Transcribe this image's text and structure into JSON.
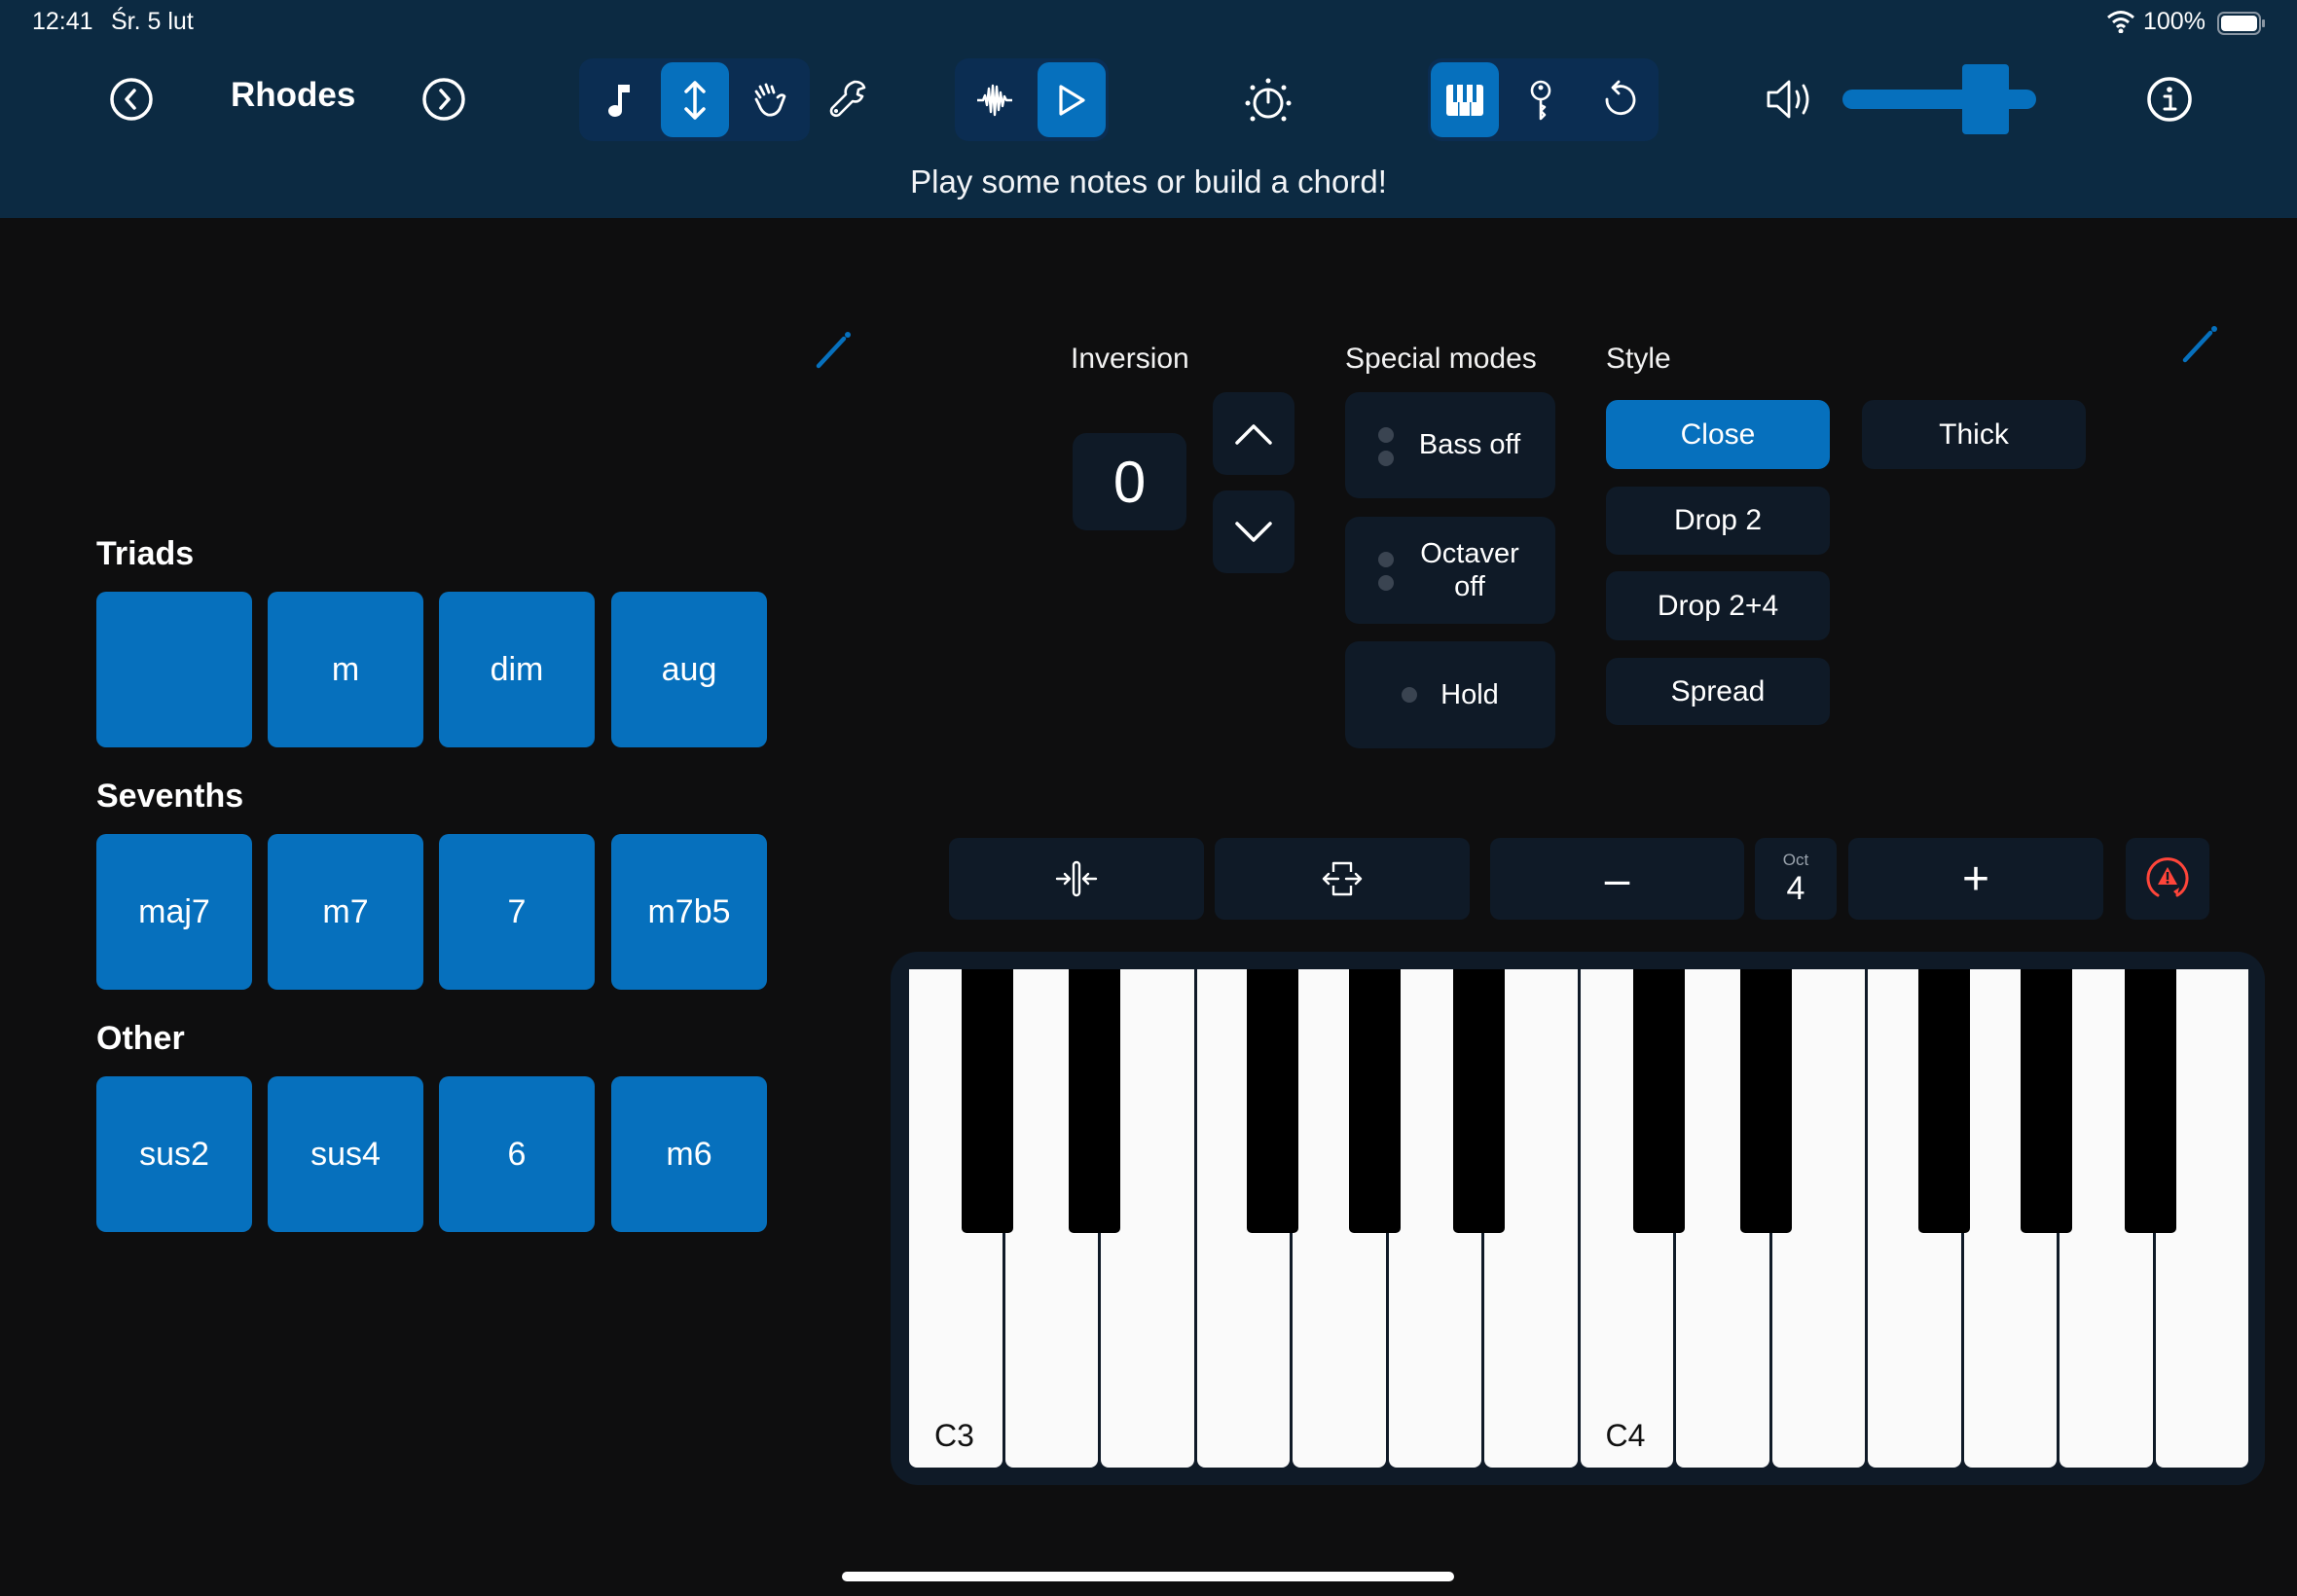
{
  "status_bar": {
    "time": "12:41",
    "date": "Śr. 5 lut",
    "battery": "100%",
    "wifi_icon": "wifi-icon",
    "battery_icon": "battery-full-icon"
  },
  "header": {
    "instrument_name": "Rhodes",
    "prev_icon": "chevron-left-circle-icon",
    "next_icon": "chevron-right-circle-icon",
    "mode_group": [
      {
        "icon": "music-note-icon",
        "active": false
      },
      {
        "icon": "up-down-arrow-icon",
        "active": true
      },
      {
        "icon": "hand-icon",
        "active": false
      }
    ],
    "settings_icon": "wrench-icon",
    "playback_group": [
      {
        "icon": "waveform-icon",
        "active": false
      },
      {
        "icon": "play-icon",
        "active": true
      }
    ],
    "metronome_icon": "metronome-dial-icon",
    "view_group": [
      {
        "icon": "piano-keys-icon",
        "active": true
      },
      {
        "icon": "key-icon",
        "active": false
      },
      {
        "icon": "undo-icon",
        "active": false
      }
    ],
    "volume_icon": "speaker-icon",
    "volume_level": 0.8,
    "info_icon": "info-icon",
    "subtitle": "Play some notes or build a chord!"
  },
  "chords": {
    "sections": [
      {
        "title": "Triads",
        "buttons": [
          "",
          "m",
          "dim",
          "aug"
        ]
      },
      {
        "title": "Sevenths",
        "buttons": [
          "maj7",
          "m7",
          "7",
          "m7b5"
        ]
      },
      {
        "title": "Other",
        "buttons": [
          "sus2",
          "sus4",
          "6",
          "m6"
        ]
      }
    ]
  },
  "controls": {
    "inversion_label": "Inversion",
    "inversion_value": "0",
    "special_modes_label": "Special modes",
    "modes": [
      "Bass off",
      "Octaver off",
      "Hold"
    ],
    "style_label": "Style",
    "styles": [
      "Close",
      "Thick",
      "Drop 2",
      "Drop 2+4",
      "Spread"
    ],
    "active_style": "Close"
  },
  "keyboard_toolbar": {
    "compress_icon": "compress-horizontal-icon",
    "expand_icon": "expand-horizontal-icon",
    "minus_label": "–",
    "octave_caption": "Oct",
    "octave_value": "4",
    "plus_label": "+",
    "panic_icon": "panic-warning-icon"
  },
  "piano": {
    "white_keys": [
      "C3",
      "D3",
      "E3",
      "F3",
      "G3",
      "A3",
      "B3",
      "C4",
      "D4",
      "E4",
      "F4",
      "G4",
      "A4",
      "B4"
    ],
    "labels": {
      "0": "C3",
      "7": "C4"
    },
    "black_keys": [
      "C#3",
      "D#3",
      "F#3",
      "G#3",
      "A#3",
      "C#4",
      "D#4",
      "F#4",
      "G#4",
      "A#4"
    ]
  }
}
